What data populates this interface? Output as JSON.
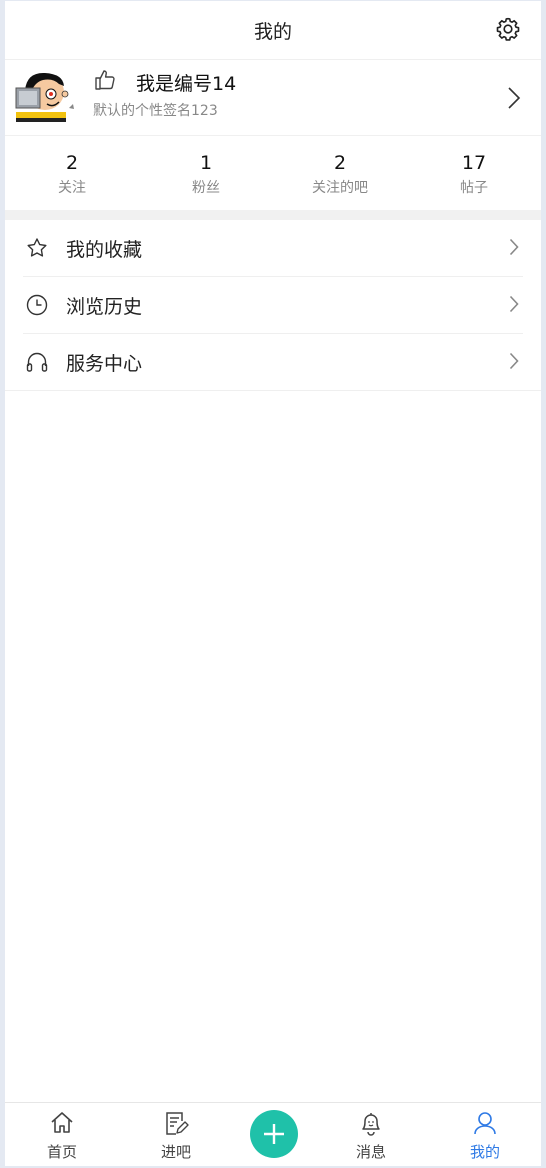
{
  "header": {
    "title": "我的",
    "settings_icon": "gear-icon"
  },
  "profile": {
    "avatar_icon": "cartoon-avatar",
    "like_icon": "thumbs-up-icon",
    "username": "我是编号14",
    "signature": "默认的个性签名123"
  },
  "stats": [
    {
      "value": "2",
      "label": "关注"
    },
    {
      "value": "1",
      "label": "粉丝"
    },
    {
      "value": "2",
      "label": "关注的吧"
    },
    {
      "value": "17",
      "label": "帖子"
    }
  ],
  "menu": [
    {
      "label": "我的收藏",
      "icon": "star-icon"
    },
    {
      "label": "浏览历史",
      "icon": "clock-icon"
    },
    {
      "label": "服务中心",
      "icon": "headset-icon"
    }
  ],
  "tabbar": {
    "tabs": [
      {
        "label": "首页",
        "icon": "home-icon"
      },
      {
        "label": "进吧",
        "icon": "edit-note-icon"
      },
      {
        "label": "消息",
        "icon": "bell-icon"
      },
      {
        "label": "我的",
        "icon": "user-icon",
        "active": true
      }
    ],
    "center_icon": "plus-icon",
    "active_color": "#2f7ae5",
    "plus_color": "#1fc1a9"
  }
}
